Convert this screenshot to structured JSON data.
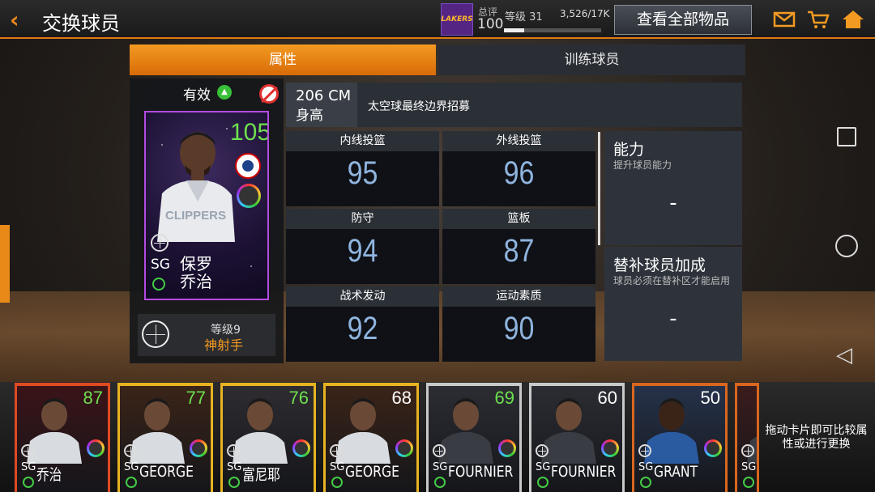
{
  "header": {
    "title": "交换球员",
    "team_logo_text": "LAKERS",
    "total_label": "总评",
    "total_value": "100",
    "level_label": "等级 31",
    "xp_text": "3,526/17K",
    "xp_progress": 0.21,
    "view_all_button": "查看全部物品"
  },
  "tabs": [
    {
      "label": "属性",
      "active": true
    },
    {
      "label": "训练球员",
      "active": false
    }
  ],
  "card": {
    "status": "有效",
    "rating": "105",
    "position": "SG",
    "name": "保罗\n乔治",
    "level": "等级9",
    "level_title": "神射手",
    "rating_color": "#6de04e"
  },
  "info": {
    "height_value": "206 CM",
    "height_label": "身高",
    "description": "太空球最终边界招募"
  },
  "stats": [
    {
      "label": "内线投篮",
      "value": "95"
    },
    {
      "label": "外线投篮",
      "value": "96"
    },
    {
      "label": "防守",
      "value": "94"
    },
    {
      "label": "篮板",
      "value": "87"
    },
    {
      "label": "战术发动",
      "value": "92"
    },
    {
      "label": "运动素质",
      "value": "90"
    }
  ],
  "right_panels": [
    {
      "title": "能力",
      "subtitle": "提升球员能力",
      "value": "-"
    },
    {
      "title": "替补球员加成",
      "subtitle": "球员必须在替补区才能启用",
      "value": "-"
    }
  ],
  "bench": [
    {
      "rating": "87",
      "position": "SG",
      "name": "乔治",
      "border": "#e04a22",
      "rating_color": "#6de04e"
    },
    {
      "rating": "77",
      "position": "SG",
      "name": "GEORGE",
      "border": "#e8b321",
      "rating_color": "#6de04e"
    },
    {
      "rating": "76",
      "position": "SG",
      "name": "富尼耶",
      "border": "#e8b321",
      "rating_color": "#6de04e"
    },
    {
      "rating": "68",
      "position": "SG",
      "name": "GEORGE",
      "border": "#e8b321",
      "rating_color": "#ffffff"
    },
    {
      "rating": "69",
      "position": "SG",
      "name": "FOURNIER",
      "border": "#c9c9c9",
      "rating_color": "#6de04e"
    },
    {
      "rating": "60",
      "position": "SG",
      "name": "FOURNIER",
      "border": "#c9c9c9",
      "rating_color": "#ffffff"
    },
    {
      "rating": "50",
      "position": "SG",
      "name": "GRANT",
      "border": "#d9661f",
      "rating_color": "#ffffff"
    },
    {
      "rating": "",
      "position": "SG",
      "name": "",
      "border": "#d9661f",
      "rating_color": "#ffffff"
    }
  ],
  "hint": "拖动卡片即可比较属性或进行更换",
  "colors": {
    "accent": "#f39a22",
    "stat_value": "#8fb4de"
  }
}
